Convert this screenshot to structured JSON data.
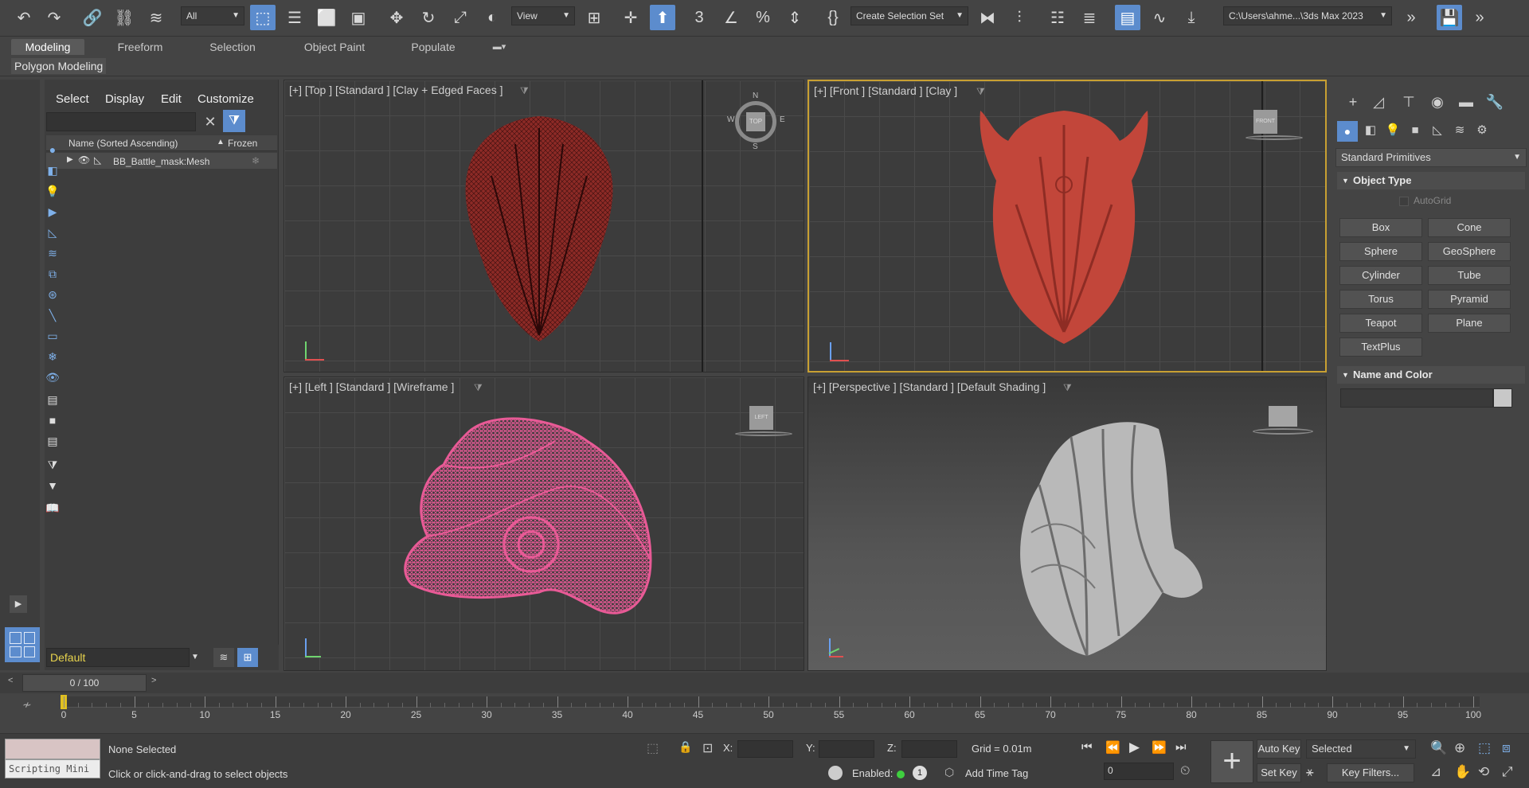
{
  "toolbar": {
    "selection_filter": "All",
    "ref_coord": "View",
    "create_selection_set": "Create Selection Set",
    "project_path": "C:\\Users\\ahme...\\3ds Max 2023"
  },
  "ribbon": {
    "tabs": [
      "Modeling",
      "Freeform",
      "Selection",
      "Object Paint",
      "Populate"
    ],
    "sub_label": "Polygon Modeling"
  },
  "scene_explorer": {
    "menu": [
      "Select",
      "Display",
      "Edit",
      "Customize"
    ],
    "col_name": "Name (Sorted Ascending)",
    "col_frozen": "Frozen",
    "sort_indicator": "▲",
    "row_name": "BB_Battle_mask:Mesh",
    "layer_name": "Default"
  },
  "viewports": {
    "top": "[+] [Top ] [Standard ] [Clay + Edged Faces ]",
    "front": "[+] [Front ] [Standard ] [Clay ]",
    "left": "[+] [Left ] [Standard ] [Wireframe ]",
    "perspective": "[+] [Perspective ] [Standard ] [Default Shading ]",
    "compass": {
      "n": "N",
      "s": "S",
      "e": "E",
      "w": "W"
    },
    "cube_top": "TOP",
    "cube_front": "FRONT",
    "cube_left": "LEFT"
  },
  "command_panel": {
    "dropdown": "Standard Primitives",
    "object_type": "Object Type",
    "autogrid": "AutoGrid",
    "buttons": [
      "Box",
      "Cone",
      "Sphere",
      "GeoSphere",
      "Cylinder",
      "Tube",
      "Torus",
      "Pyramid",
      "Teapot",
      "Plane",
      "TextPlus"
    ],
    "name_and_color": "Name and Color"
  },
  "timeline": {
    "frame": "0 / 100",
    "ticks": [
      "0",
      "5",
      "10",
      "15",
      "20",
      "25",
      "30",
      "35",
      "40",
      "45",
      "50",
      "55",
      "60",
      "65",
      "70",
      "75",
      "80",
      "85",
      "90",
      "95",
      "100"
    ]
  },
  "status": {
    "script_label": "Scripting Mini",
    "selected": "None Selected",
    "hint": "Click or click-and-drag to select objects",
    "x_label": "X:",
    "y_label": "Y:",
    "z_label": "Z:",
    "grid": "Grid = 0.01m",
    "enabled": "Enabled:",
    "enabled_count": "1",
    "add_time_tag": "Add Time Tag",
    "auto_key": "Auto Key",
    "set_key": "Set Key",
    "selected_dd": "Selected",
    "key_filters": "Key Filters...",
    "frame_field": "0"
  },
  "colors": {
    "accent": "#5c8ccd",
    "active_viewport_border": "#c8a032",
    "wireframe": "#e85a96",
    "clay": "#c2463a"
  }
}
